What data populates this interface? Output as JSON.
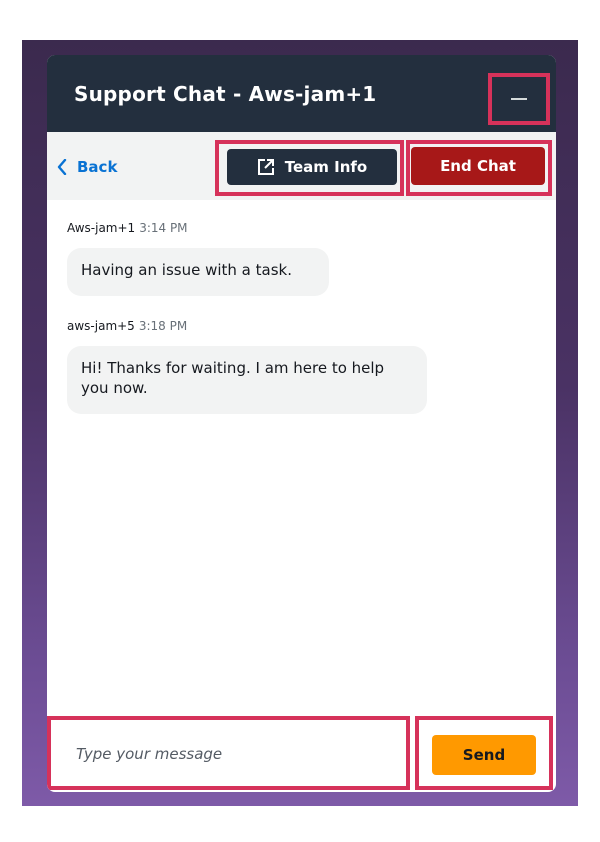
{
  "header": {
    "title": "Support Chat - Aws-jam+1",
    "minimize_icon": "minimize-icon"
  },
  "toolbar": {
    "back_label": "Back",
    "team_info_label": "Team Info",
    "end_chat_label": "End Chat"
  },
  "messages": [
    {
      "sender": "Aws-jam+1",
      "time": "3:14 PM",
      "text": "Having an issue with a task."
    },
    {
      "sender": "aws-jam+5",
      "time": "3:18 PM",
      "text": "Hi! Thanks for waiting. I am here to help you now."
    }
  ],
  "composer": {
    "placeholder": "Type your message",
    "value": "",
    "send_label": "Send"
  },
  "colors": {
    "header_bg": "#232f3e",
    "end_chat": "#a71818",
    "send": "#ff9900",
    "highlight": "#d6325a",
    "link": "#0972d3"
  }
}
